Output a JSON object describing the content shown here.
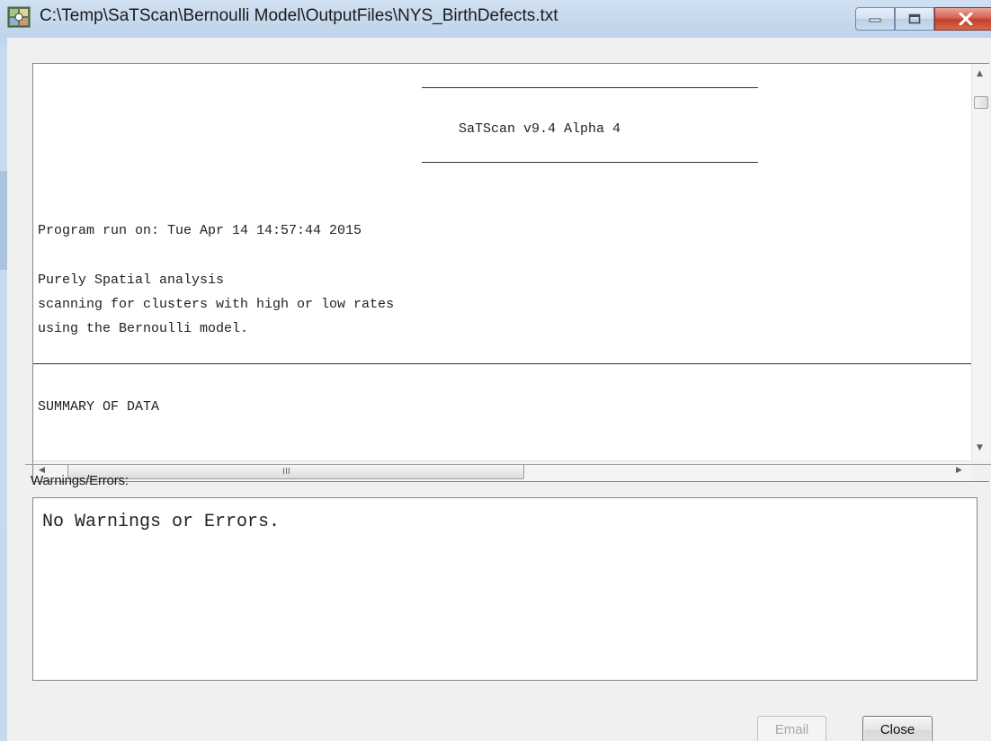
{
  "window": {
    "title": "C:\\Temp\\SaTScan\\Bernoulli Model\\OutputFiles\\NYS_BirthDefects.txt",
    "icon": "satscan-app-icon",
    "controls": [
      "minimize-icon",
      "maximize-icon",
      "close-icon"
    ]
  },
  "results": {
    "header": "SaTScan v9.4 Alpha 4",
    "run_line": "Program run on: Tue Apr 14 14:57:44 2015",
    "analysis_lines": [
      "Purely Spatial analysis",
      "scanning for clusters with high or low rates",
      "using the Bernoulli model."
    ],
    "section_heading": "SUMMARY OF DATA",
    "hscroll_grip": "III"
  },
  "warnings": {
    "label": "Warnings/Errors:",
    "text": "No Warnings or Errors."
  },
  "buttons": {
    "email": "Email",
    "close": "Close"
  }
}
